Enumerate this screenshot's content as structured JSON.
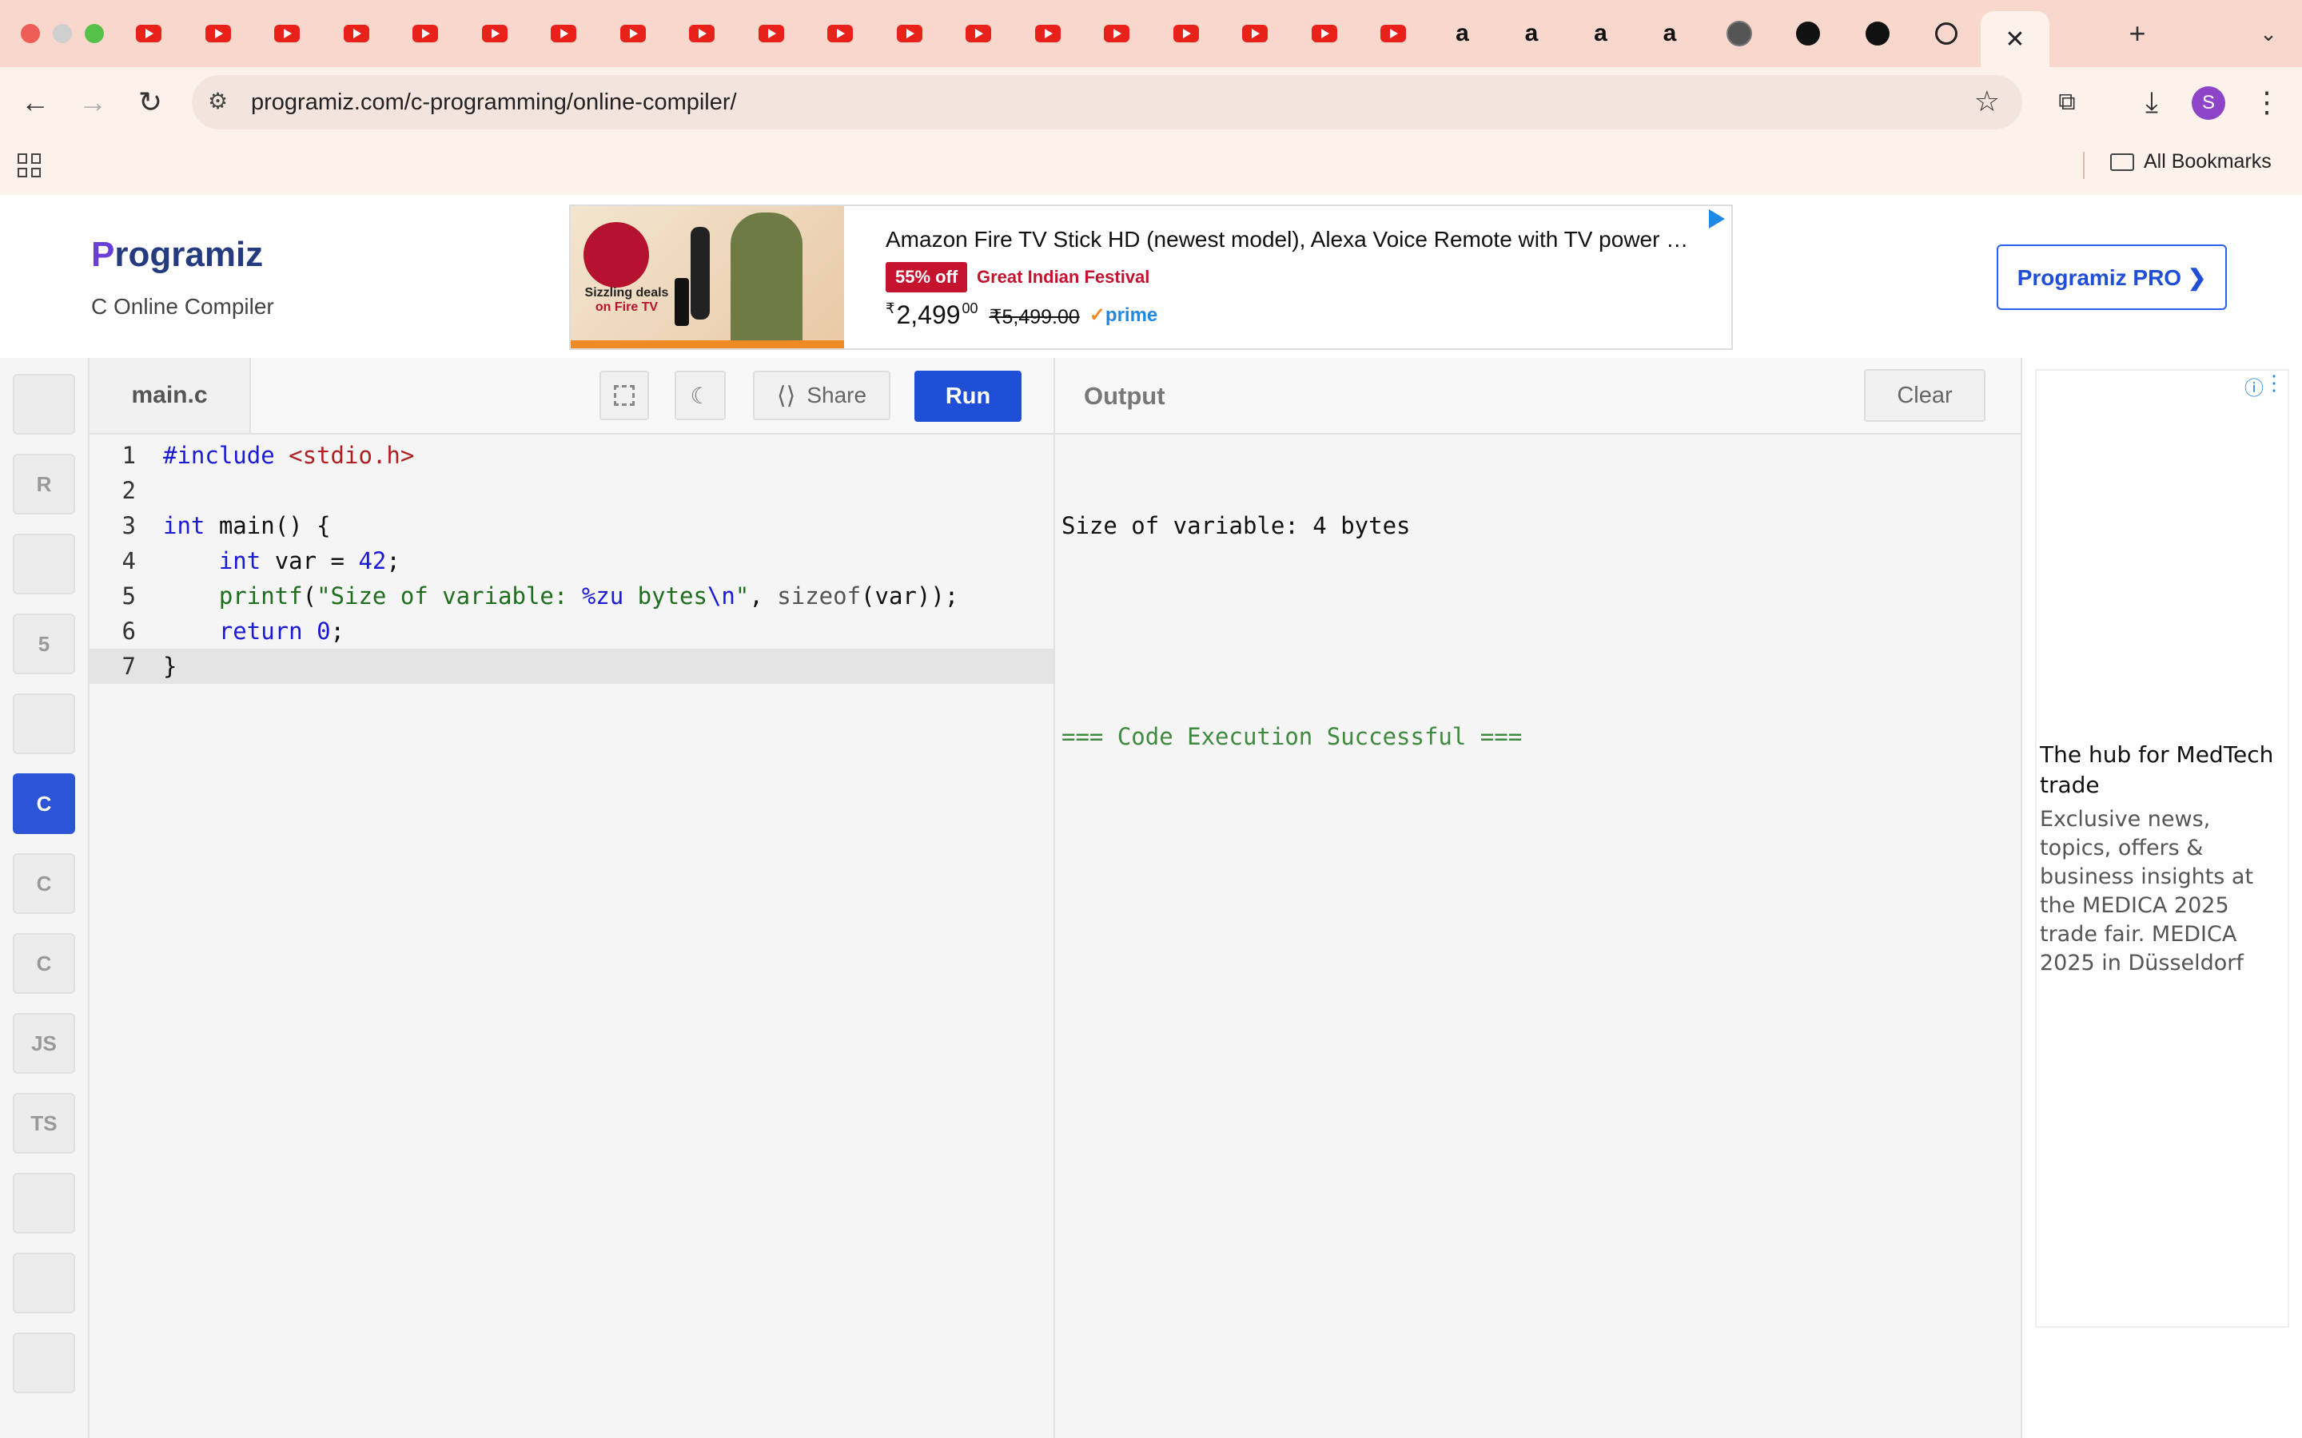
{
  "browser": {
    "url": "programiz.com/c-programming/online-compiler/",
    "bookmarks_label": "All Bookmarks",
    "profile_initial": "S",
    "tabs": [
      {
        "icon": "youtube-icon"
      },
      {
        "icon": "youtube-icon"
      },
      {
        "icon": "youtube-icon"
      },
      {
        "icon": "youtube-icon"
      },
      {
        "icon": "youtube-icon"
      },
      {
        "icon": "youtube-icon"
      },
      {
        "icon": "youtube-icon"
      },
      {
        "icon": "youtube-icon"
      },
      {
        "icon": "youtube-icon"
      },
      {
        "icon": "youtube-icon"
      },
      {
        "icon": "youtube-icon"
      },
      {
        "icon": "youtube-icon"
      },
      {
        "icon": "youtube-icon"
      },
      {
        "icon": "youtube-icon"
      },
      {
        "icon": "youtube-icon"
      },
      {
        "icon": "youtube-icon"
      },
      {
        "icon": "youtube-icon"
      },
      {
        "icon": "youtube-icon"
      },
      {
        "icon": "youtube-icon"
      },
      {
        "icon": "amazon-icon"
      },
      {
        "icon": "amazon-icon"
      },
      {
        "icon": "amazon-icon"
      },
      {
        "icon": "amazon-icon"
      },
      {
        "icon": "globe-icon"
      },
      {
        "icon": "github-icon"
      },
      {
        "icon": "github-icon"
      },
      {
        "icon": "openai-icon"
      }
    ]
  },
  "site": {
    "logo_text": "rogramiz",
    "logo_first": "P",
    "subtitle": "C Online Compiler",
    "pro_button": "Programiz PRO ❯"
  },
  "ad": {
    "title": "Amazon Fire TV Stick HD (newest model), Alexa Voice Remote with TV power …",
    "discount": "55% off",
    "event": "Great Indian Festival",
    "price_symbol": "₹",
    "price": "2,499",
    "price_fraction": "00",
    "old_price": "₹5,499.00",
    "prime": "prime",
    "image_caption": "Sizzling deals",
    "image_caption2": "on Fire TV"
  },
  "languages": [
    {
      "name": "python-icon",
      "label": ""
    },
    {
      "name": "r-icon",
      "label": "R"
    },
    {
      "name": "sql-icon",
      "label": ""
    },
    {
      "name": "html5-icon",
      "label": "5"
    },
    {
      "name": "java-icon",
      "label": ""
    },
    {
      "name": "c-icon",
      "label": "C"
    },
    {
      "name": "cpp-icon",
      "label": "C"
    },
    {
      "name": "csharp-icon",
      "label": "C"
    },
    {
      "name": "js-icon",
      "label": "JS"
    },
    {
      "name": "ts-icon",
      "label": "TS"
    },
    {
      "name": "stack-icon",
      "label": ""
    },
    {
      "name": "swift-icon",
      "label": ""
    },
    {
      "name": "kotlin-icon",
      "label": ""
    }
  ],
  "editor": {
    "file_name": "main.c",
    "share_label": "Share",
    "run_label": "Run",
    "lines": [
      {
        "n": "1",
        "tokens": [
          {
            "t": "#include ",
            "c": "kw"
          },
          {
            "t": "<stdio.h>",
            "c": "inc"
          }
        ]
      },
      {
        "n": "2",
        "tokens": []
      },
      {
        "n": "3",
        "tokens": [
          {
            "t": "int",
            "c": "kw"
          },
          {
            "t": " main() {",
            "c": ""
          }
        ]
      },
      {
        "n": "4",
        "tokens": [
          {
            "t": "    ",
            "c": ""
          },
          {
            "t": "int",
            "c": "kw"
          },
          {
            "t": " var = ",
            "c": ""
          },
          {
            "t": "42",
            "c": "num"
          },
          {
            "t": ";",
            "c": ""
          }
        ]
      },
      {
        "n": "5",
        "tokens": [
          {
            "t": "    ",
            "c": ""
          },
          {
            "t": "printf",
            "c": "str"
          },
          {
            "t": "(",
            "c": ""
          },
          {
            "t": "\"Size of variable: ",
            "c": "str"
          },
          {
            "t": "%zu",
            "c": "kw"
          },
          {
            "t": " bytes",
            "c": "str"
          },
          {
            "t": "\\n",
            "c": "kw"
          },
          {
            "t": "\"",
            "c": "str"
          },
          {
            "t": ", ",
            "c": ""
          },
          {
            "t": "sizeof",
            "c": "fn"
          },
          {
            "t": "(var));",
            "c": ""
          }
        ]
      },
      {
        "n": "6",
        "tokens": [
          {
            "t": "    ",
            "c": ""
          },
          {
            "t": "return",
            "c": "kw"
          },
          {
            "t": " ",
            "c": ""
          },
          {
            "t": "0",
            "c": "num"
          },
          {
            "t": ";",
            "c": ""
          }
        ]
      },
      {
        "n": "7",
        "tokens": [
          {
            "t": "}",
            "c": ""
          }
        ]
      }
    ]
  },
  "output": {
    "title": "Output",
    "clear_label": "Clear",
    "line1": "Size of variable: 4 bytes",
    "line2": "=== Code Execution Successful ==="
  },
  "side_ad": {
    "heading": "The hub for MedTech trade",
    "body": "Exclusive news, topics, offers & business insights at the MEDICA 2025 trade fair. MEDICA 2025 in Düsseldorf"
  }
}
